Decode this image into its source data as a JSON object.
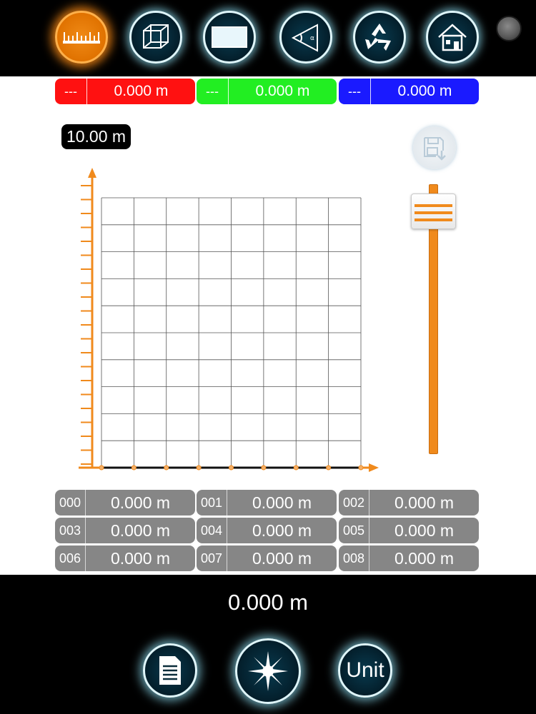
{
  "toolbar": {
    "buttons": [
      {
        "icon": "ruler-icon",
        "active": true
      },
      {
        "icon": "cube-icon",
        "active": false
      },
      {
        "icon": "rectangle-icon",
        "active": false
      },
      {
        "icon": "angle-icon",
        "active": false
      },
      {
        "icon": "recycle-icon",
        "active": false
      },
      {
        "icon": "home-icon",
        "active": false
      }
    ]
  },
  "header_values": [
    {
      "code": "---",
      "value": "0.000 m",
      "color": "#ff1111"
    },
    {
      "code": "---",
      "value": "0.000 m",
      "color": "#22ee22"
    },
    {
      "code": "---",
      "value": "0.000 m",
      "color": "#1a1aff"
    }
  ],
  "scale_label": "10.00 m",
  "chart_data": {
    "type": "line",
    "title": "",
    "xlabel": "",
    "ylabel": "",
    "x": [
      0,
      1,
      2,
      3,
      4,
      5,
      6,
      7,
      8
    ],
    "series": [
      {
        "values": [
          0,
          0,
          0,
          0,
          0,
          0,
          0,
          0,
          0
        ]
      }
    ],
    "ylim": [
      0,
      10
    ],
    "grid": true,
    "accent_color": "#f08a1c"
  },
  "slider": {
    "level": 0.9
  },
  "measurements": [
    {
      "code": "000",
      "value": "0.000 m"
    },
    {
      "code": "001",
      "value": "0.000 m"
    },
    {
      "code": "002",
      "value": "0.000 m"
    },
    {
      "code": "003",
      "value": "0.000 m"
    },
    {
      "code": "004",
      "value": "0.000 m"
    },
    {
      "code": "005",
      "value": "0.000 m"
    },
    {
      "code": "006",
      "value": "0.000 m"
    },
    {
      "code": "007",
      "value": "0.000 m"
    },
    {
      "code": "008",
      "value": "0.000 m"
    }
  ],
  "total": "0.000 m",
  "bottom_bar": {
    "unit_label": "Unit",
    "icons": [
      "document-icon",
      "star-icon",
      "unit-icon"
    ]
  }
}
